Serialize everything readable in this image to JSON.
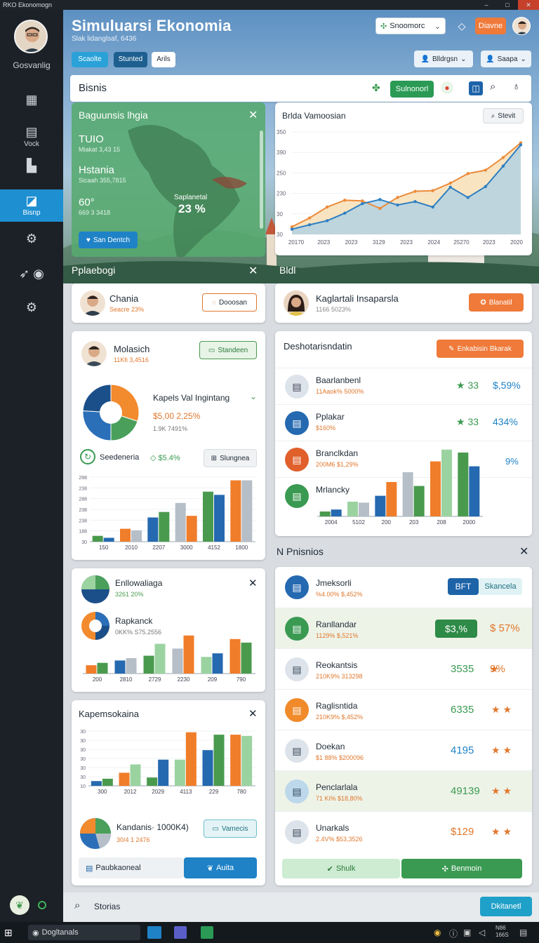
{
  "window": {
    "title": "RKO Ekonomogn"
  },
  "sidebar": {
    "user_name": "Gosvanlig",
    "items": [
      {
        "label": "",
        "icon": "grid-icon"
      },
      {
        "label": "Vock",
        "icon": "calendar-icon"
      },
      {
        "label": "",
        "icon": "building-icon"
      },
      {
        "label": "Bisnp",
        "icon": "chart-icon",
        "active": true
      },
      {
        "label": "",
        "icon": "badge-gear-icon"
      },
      {
        "label": "",
        "icon": "rocket-icon"
      },
      {
        "label": "",
        "icon": "gear-icon"
      }
    ]
  },
  "header": {
    "title": "Simuluarsi Ekonomia",
    "subtitle": "Slak lidanglsaf, 6436",
    "chips": [
      "Scaolte",
      "Stunted",
      "Arils"
    ],
    "dropdown_label": "Snoomorc",
    "primary_button": "Diavne",
    "profile_left": "Blldrgsn",
    "profile_right": "Saapa"
  },
  "toolbar": {
    "section_title": "Bisnis",
    "action_button": "Sulnonorl"
  },
  "map_card": {
    "title": "Baguunsis lhgia",
    "stats": [
      {
        "value": "TUIO",
        "sub": "Miakat 3,43 15"
      },
      {
        "value": "Hstania",
        "sub": "Sicaah 355,7815"
      },
      {
        "value": "60°",
        "sub": "669 3 3418"
      }
    ],
    "region_label": "Saplanetal",
    "region_value": "23 %",
    "button": "San Dentch",
    "footer_title": "Pplaebogi"
  },
  "trend_card": {
    "title": "Brlda Vamoosian",
    "search_label": "Stevit",
    "footer_title": "Bldl"
  },
  "chart_data": [
    {
      "type": "area",
      "title": "Brlda Vamoosian",
      "categories": [
        "20170",
        "2023",
        "2023",
        "3129",
        "2023",
        "2024",
        "25270",
        "2023",
        "2020"
      ],
      "series": [
        {
          "values": [
            22,
            48,
            80,
            100,
            98,
            76,
            108,
            126,
            128,
            150,
            178,
            188,
            225,
            268
          ]
        },
        {
          "values": [
            15,
            28,
            40,
            62,
            90,
            102,
            86,
            96,
            80,
            138,
            108,
            140,
            200,
            262
          ]
        }
      ],
      "y_ticks": [
        "350",
        "390",
        "250",
        "230",
        "30",
        "30"
      ],
      "colors": {
        "line_a": "#ec8b3b",
        "line_b": "#2f7fc1"
      }
    },
    {
      "type": "pie",
      "title": "Kapels Val Ingintang",
      "values": [
        30,
        20,
        26,
        24
      ],
      "colors": [
        "#f28a2e",
        "#4aa05a",
        "#2a6fb8",
        "#1b4f8a"
      ]
    },
    {
      "type": "bar",
      "title": "Molasich",
      "categories": [
        "150",
        "2010",
        "2207",
        "3000",
        "4152",
        "1800"
      ],
      "series": [
        {
          "name": "a",
          "values": [
            18,
            40,
            75,
            120,
            155,
            190
          ]
        },
        {
          "name": "b",
          "values": [
            12,
            35,
            92,
            80,
            145,
            190
          ]
        }
      ],
      "y_ticks": [
        "298",
        "238",
        "288",
        "238",
        "238",
        "188",
        "30"
      ],
      "colors": [
        "#4a9a4e",
        "#f07d2a",
        "#2569b0",
        "#b6bec7"
      ]
    },
    {
      "type": "bar",
      "title": "Deshotarisndatin",
      "categories": [
        "2004",
        "5102",
        "200",
        "203",
        "208",
        "2000"
      ],
      "series": [
        {
          "name": "a",
          "values": [
            10,
            30,
            42,
            90,
            112,
            130
          ]
        },
        {
          "name": "b",
          "values": [
            14,
            28,
            70,
            62,
            136,
            102
          ]
        }
      ],
      "colors": [
        "#4a9a4e",
        "#9bd3a0",
        "#2569b0",
        "#b6bec7",
        "#f07d2a"
      ]
    },
    {
      "type": "bar",
      "title": "Enllowaliaga",
      "categories": [
        "200",
        "2810",
        "2729",
        "2230",
        "209",
        "790"
      ],
      "series": [
        {
          "name": "a",
          "values": [
            14,
            22,
            30,
            42,
            28,
            58
          ]
        },
        {
          "name": "b",
          "values": [
            18,
            26,
            50,
            64,
            34,
            52
          ]
        }
      ],
      "colors": [
        "#f07d2a",
        "#2569b0",
        "#4a9a4e",
        "#b6bec7",
        "#9bd3a0"
      ]
    },
    {
      "type": "bar",
      "title": "Kapemsokaina",
      "categories": [
        "300",
        "2012",
        "2029",
        "4113",
        "229",
        "780"
      ],
      "series": [
        {
          "name": "a",
          "values": [
            8,
            22,
            14,
            44,
            60,
            86
          ]
        },
        {
          "name": "b",
          "values": [
            12,
            36,
            44,
            90,
            86,
            84
          ]
        }
      ],
      "y_ticks": [
        "30",
        "30",
        "30",
        "30",
        "30",
        "30",
        "10"
      ],
      "colors": [
        "#2569b0",
        "#f07d2a",
        "#4a9a4e",
        "#9bd3a0"
      ]
    }
  ],
  "cards": {
    "chania": {
      "name": "Chania",
      "sub": "Seacre 23%",
      "button": "Dooosan"
    },
    "kaglartali": {
      "name": "Kaglartali Insaparsla",
      "sub": "1166 5023%",
      "button": "Blanatil"
    },
    "molasich": {
      "name": "Molasich",
      "sub": "11Kfi 3,4516",
      "button": "Standeen",
      "pie_title": "Kapels Val Ingintang",
      "pie_value": "$5,00 2,25%",
      "pie_sub": "1.9K 7491%",
      "legend_label": "Seedeneria",
      "legend_value": "$5.4%",
      "secondary_button": "Slungnea"
    },
    "desho": {
      "title": "Deshotarisndatin",
      "button": "Enkabisin Bkarak",
      "footer_value": "9%"
    },
    "enll": {
      "title": "Enllowaliaga",
      "sub": "3261 20%",
      "title2": "Rapkanck",
      "sub2": "0KK% S75.2556"
    },
    "kapem": {
      "title": "Kapemsokaina",
      "pie_title": "Kandanis· 1000K4)",
      "pie_sub": "30/4 1 2476",
      "button": "Vamecis",
      "footer_left": "Paubkaoneal",
      "footer_right": "Auita"
    },
    "np": {
      "title": "N Pnisnios",
      "button_left": "BFT",
      "button_right": "Skancela",
      "footer_left": "Shulk",
      "footer_right": "Benmoin"
    }
  },
  "desho_rows": [
    {
      "name": "Baarlanbenl",
      "sub": "11Aaok% 5000%",
      "metric": "33",
      "value": "$,59%",
      "icon_color": "#dde3ea"
    },
    {
      "name": "Pplakar",
      "sub": "$160%",
      "metric": "33",
      "value": "434%",
      "icon_color": "#2569b0"
    },
    {
      "name": "Branclkdan",
      "sub": "200M6 $1,29%",
      "metric": "",
      "value": "",
      "icon_color": "#e05f2b"
    },
    {
      "name": "Mrlancky",
      "sub": "",
      "metric": "",
      "value": "",
      "icon_color": "#3a9a52"
    }
  ],
  "np_rows": [
    {
      "name": "Jmeksorli",
      "sub": "%4.00% $,452%",
      "value": "",
      "rating": "",
      "icon_color": "#2569b0",
      "highlight": false
    },
    {
      "name": "Ranllandar",
      "sub": "1129% $,521%",
      "value": "$3,%",
      "rating": "$ 57%",
      "icon_color": "#3a9a52",
      "highlight": true
    },
    {
      "name": "Reokantsis",
      "sub": "210K9% 313298",
      "value": "3535",
      "rating": "9%",
      "icon_color": "#dde3ea",
      "highlight": false
    },
    {
      "name": "Raglisntida",
      "sub": "210K9% $,452%",
      "value": "6335",
      "rating": "",
      "icon_color": "#f08a2a",
      "highlight": false
    },
    {
      "name": "Doekan",
      "sub": "$1 88% $200096",
      "value": "4195",
      "rating": "",
      "icon_color": "#dde3ea",
      "highlight": false
    },
    {
      "name": "Penclarlala",
      "sub": "71 Ki% $18,80%",
      "value": "49139",
      "rating": "",
      "icon_color": "#bcd8ea",
      "highlight": true
    },
    {
      "name": "Unarkals",
      "sub": "2.4V% $53,3526",
      "value": "$129",
      "rating": "",
      "icon_color": "#dde3ea",
      "highlight": false
    }
  ],
  "statusbar": {
    "search_label": "Storias",
    "button": "Dkitanetl"
  },
  "taskbar": {
    "search": "Dogltanals",
    "tray_text": "N86 166S"
  }
}
